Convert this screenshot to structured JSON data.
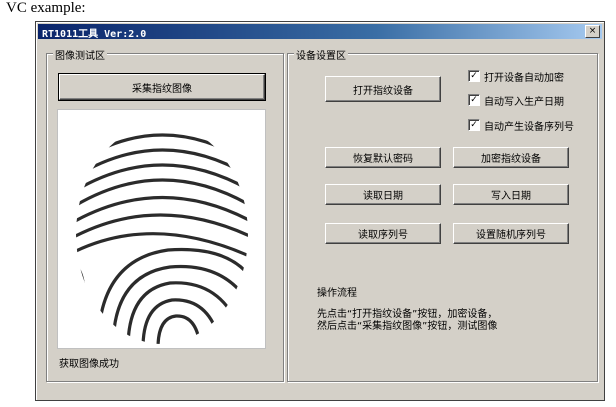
{
  "caption": "VC example:",
  "window": {
    "title": "RT1011工具 Ver:2.0",
    "close_glyph": "×"
  },
  "image_group": {
    "legend": "图像测试区",
    "capture_button": "采集指纹图像",
    "status": "获取图像成功"
  },
  "device_group": {
    "legend": "设备设置区",
    "open_button": "打开指纹设备",
    "checkboxes": [
      {
        "label": "打开设备自动加密",
        "checked": true
      },
      {
        "label": "自动写入生产日期",
        "checked": true
      },
      {
        "label": "自动产生设备序列号",
        "checked": true
      }
    ],
    "check_glyph": "✓",
    "restore_password_button": "恢复默认密码",
    "encrypt_button": "加密指纹设备",
    "read_date_button": "读取日期",
    "write_date_button": "写入日期",
    "read_serial_button": "读取序列号",
    "set_random_serial_button": "设置随机序列号",
    "procedure_title": "操作流程",
    "procedure_line1": "先点击“打开指纹设备”按钮，加密设备，",
    "procedure_line2": "然后点击“采集指纹图像”按钮，测试图像"
  }
}
